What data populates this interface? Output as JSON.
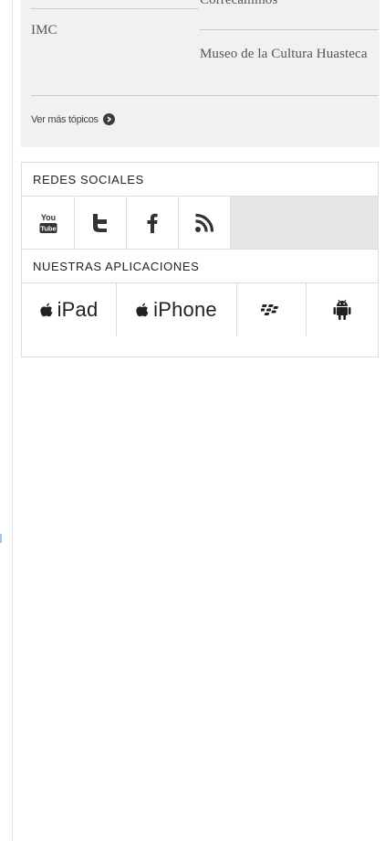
{
  "topics": {
    "items": [
      {
        "label": "Correcaminos"
      },
      {
        "label": "IMC"
      },
      {
        "label": "Museo de la Cultura Huasteca"
      }
    ],
    "more_label": "Ver más tópicos"
  },
  "social": {
    "header": "REDES SOCIALES",
    "items": [
      {
        "name": "youtube",
        "icon": "youtube-icon",
        "text_top": "You",
        "text_bottom": "Tube"
      },
      {
        "name": "twitter",
        "icon": "twitter-icon"
      },
      {
        "name": "facebook",
        "icon": "facebook-icon"
      },
      {
        "name": "rss",
        "icon": "rss-icon"
      }
    ]
  },
  "apps": {
    "header": "NUESTRAS APLICACIONES",
    "items": [
      {
        "label": "iPad",
        "icon": "apple-icon"
      },
      {
        "label": "iPhone",
        "icon": "apple-icon"
      },
      {
        "label": "",
        "icon": "blackberry-icon"
      },
      {
        "label": "",
        "icon": "android-icon"
      }
    ]
  },
  "colors": {
    "panel_bg": "#f1f1f1",
    "border": "#dddddd",
    "filler": "#e6e6e6",
    "text": "#222222"
  }
}
